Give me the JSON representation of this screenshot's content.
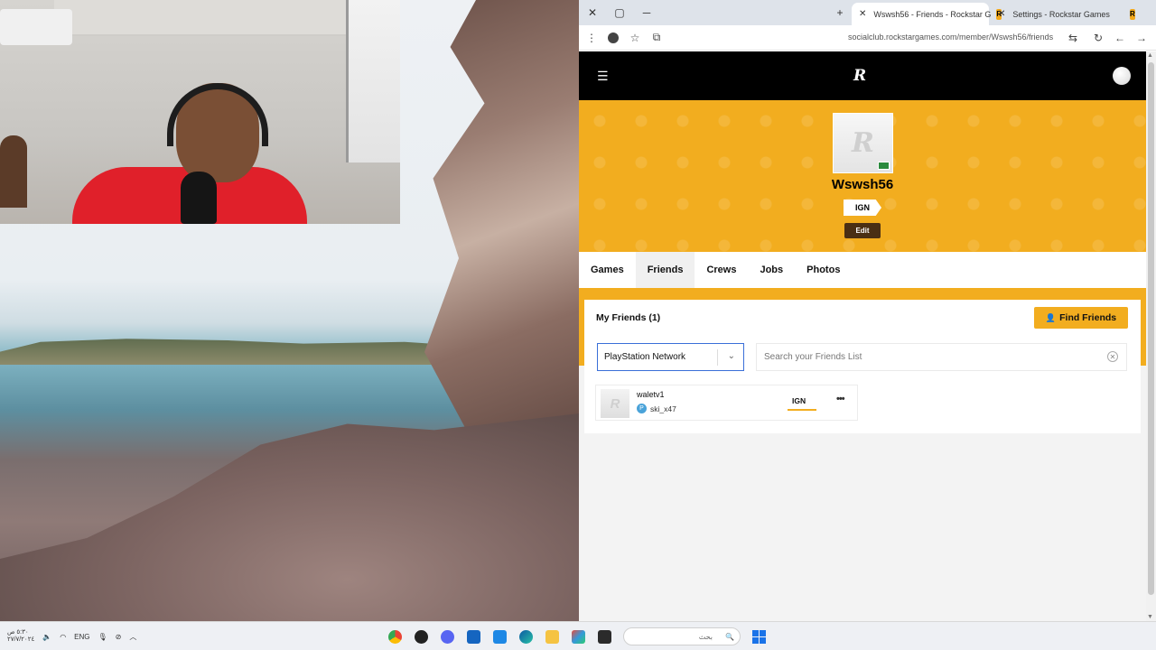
{
  "browser": {
    "tabs": [
      {
        "title": "Wswsh56 - Friends - Rockstar G",
        "active": true
      },
      {
        "title": "Settings - Rockstar Games",
        "active": false
      }
    ],
    "url": "socialclub.rockstargames.com/member/Wswsh56/friends"
  },
  "site": {
    "logo": "R",
    "profile": {
      "username": "Wswsh56",
      "ign_label": "IGN",
      "edit_label": "Edit"
    },
    "nav": [
      "Games",
      "Friends",
      "Crews",
      "Jobs",
      "Photos"
    ],
    "active_nav": "Friends",
    "friends": {
      "title": "My Friends (1)",
      "find_button": "Find Friends",
      "platform": "PlayStation Network",
      "search_placeholder": "Search your Friends List",
      "list": [
        {
          "name": "waletv1",
          "psn": "ski_x47",
          "ign": "IGN",
          "more": "•••"
        }
      ]
    }
  },
  "taskbar": {
    "clock_time": "٥:٣٠ ص",
    "clock_date": "٢٧/٧/٢٠٢٤",
    "language": "ENG",
    "search_text": "بحث"
  },
  "colors": {
    "brand_yellow": "#f2ad1f",
    "header_black": "#000000",
    "edit_brown": "#4a2f14"
  }
}
